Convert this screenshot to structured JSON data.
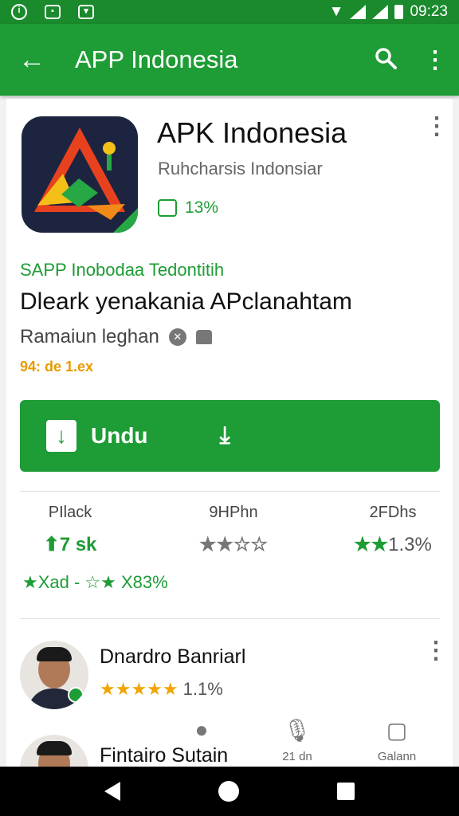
{
  "status_bar": {
    "time": "09:23"
  },
  "app_bar": {
    "back_icon": "arrow-left",
    "title": "APP Indonesia",
    "search_icon": "search",
    "more_icon": "more-vertical"
  },
  "app": {
    "name": "APK Indonesia",
    "developer": "Ruhcharsis Indonsiar",
    "rating_badge": "13%",
    "tagline": "SAPP Inobodaa Tedontitih",
    "headline": "Dleark yenakania APclanahtam",
    "subline": "Ramaiun leghan",
    "meta": "94: de 1.ex"
  },
  "install": {
    "label": "Undu"
  },
  "stats": [
    {
      "label": "PIlack",
      "value": "7 sk",
      "icon": "arrow-up"
    },
    {
      "label": "9HPhn",
      "stars_full": 2,
      "stars_total": 4
    },
    {
      "label": "2FDhs",
      "value": "1.3%",
      "stars_full": 2
    }
  ],
  "combo_line": "Xad - ☆★ X83%",
  "reviews": [
    {
      "name": "Dnardro Banriarl",
      "stars": 5,
      "pct": "1.1%"
    },
    {
      "name": "Fintairo Sutain"
    }
  ],
  "floating_actions": [
    {
      "icon": "person-icon",
      "caption": ""
    },
    {
      "icon": "microphone-icon",
      "caption": "21 dn"
    },
    {
      "icon": "tablet-icon",
      "caption": "Galann"
    }
  ],
  "colors": {
    "accent": "#1e9c35",
    "status": "#1a8a2c",
    "star": "#f0a500",
    "meta": "#e69a00"
  }
}
